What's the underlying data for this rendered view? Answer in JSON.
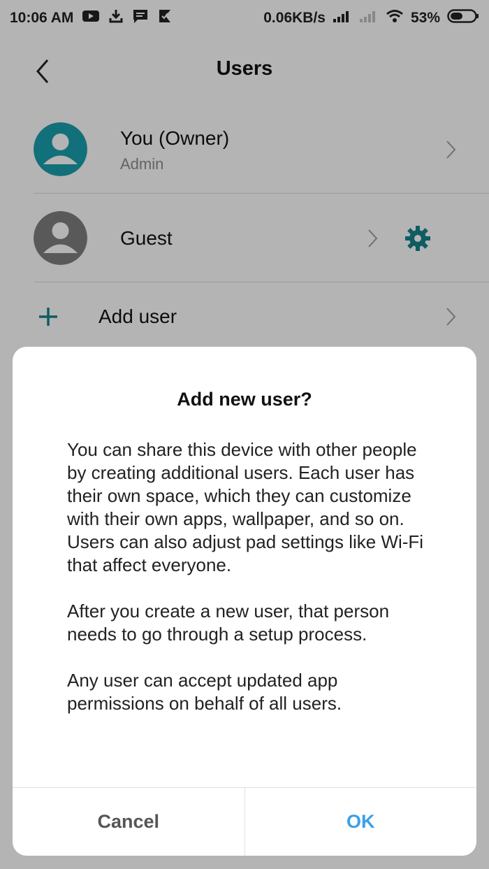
{
  "status_bar": {
    "time": "10:06 AM",
    "speed": "0.06KB/s",
    "battery": "53%",
    "battery_level": 0.53
  },
  "header": {
    "title": "Users"
  },
  "users": [
    {
      "name": "You (Owner)",
      "subtitle": "Admin",
      "avatar_color": "#1a9aa8"
    },
    {
      "name": "Guest",
      "avatar_color": "#7a7a7a"
    }
  ],
  "add_user": {
    "label": "Add user"
  },
  "colors": {
    "accent": "#157f86",
    "ok_blue": "#3aa0e8"
  },
  "dialog": {
    "title": "Add new user?",
    "paragraphs": [
      "You can share this device with other people by creating additional users. Each user has their own space, which they can customize with their own apps, wallpaper, and so on. Users can also adjust pad settings like Wi-Fi that affect everyone.",
      "After you create a new user, that person needs to go through a setup process.",
      "Any user can accept updated app permissions on behalf of all users."
    ],
    "cancel_label": "Cancel",
    "ok_label": "OK"
  }
}
